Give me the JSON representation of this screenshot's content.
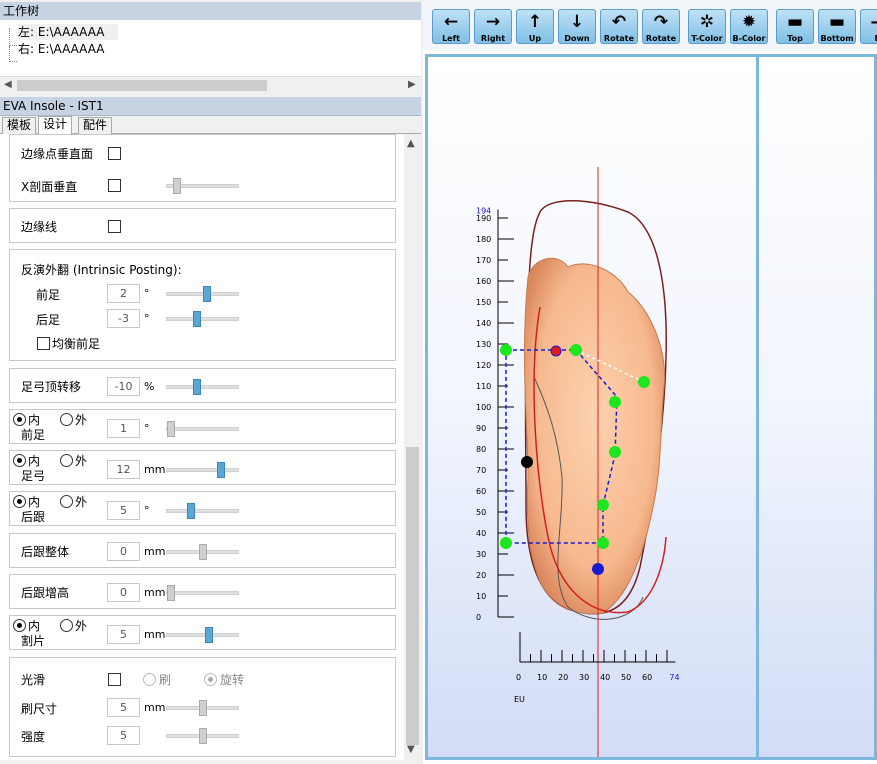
{
  "worktree": {
    "title": "工作树",
    "items": [
      "左: E:\\AAAAAA",
      "右: E:\\AAAAAA"
    ]
  },
  "section_title": "EVA Insole - IST1",
  "tabs": [
    "模板",
    "设计",
    "配件"
  ],
  "active_tab": 1,
  "settings": {
    "edge_vertical": "边缘点垂直面",
    "x_section_vertical": "X剖面垂直",
    "edge_line": "边缘线",
    "posting_title": "反演外翻 (Intrinsic Posting):",
    "forefoot": "前足",
    "forefoot_value": "2",
    "rearfoot": "后足",
    "rearfoot_value": "-3",
    "degree": "°",
    "balance_forefoot": "均衡前足",
    "arch_shift": "足弓顶转移",
    "arch_shift_value": "-10",
    "percent": "%",
    "inner": "内",
    "outer": "外",
    "forefoot_label": "前足",
    "forefoot2_value": "1",
    "arch_label": "足弓",
    "arch_value": "12",
    "mm": "mm",
    "heel_label": "后跟",
    "heel_value": "5",
    "heel_whole": "后跟整体",
    "heel_whole_value": "0",
    "heel_raise": "后跟增高",
    "heel_raise_value": "0",
    "cut_label": "割片",
    "cut_value": "5",
    "smooth": "光滑",
    "brush": "刷",
    "rotate": "旋转",
    "brush_size": "刷尺寸",
    "brush_size_value": "5",
    "strength": "强度",
    "strength_value": "5"
  },
  "toolbar": [
    {
      "label": "Left",
      "icon": "arrow-left-icon",
      "glyph": "←"
    },
    {
      "label": "Right",
      "icon": "arrow-right-icon",
      "glyph": "→"
    },
    {
      "label": "Up",
      "icon": "arrow-up-icon",
      "glyph": "↑"
    },
    {
      "label": "Down",
      "icon": "arrow-down-icon",
      "glyph": "↓"
    },
    {
      "label": "Rotate",
      "icon": "rotate-ccw-icon",
      "glyph": "↶"
    },
    {
      "label": "Rotate",
      "icon": "rotate-cw-icon",
      "glyph": "↷"
    },
    {
      "label": "T-Color",
      "icon": "top-color-icon",
      "glyph": "✲"
    },
    {
      "label": "B-Color",
      "icon": "bottom-color-icon",
      "glyph": "✹"
    },
    {
      "label": "Top",
      "icon": "top-view-icon",
      "glyph": "▬"
    },
    {
      "label": "Bottom",
      "icon": "bottom-view-icon",
      "glyph": "▬"
    },
    {
      "label": "Fr",
      "icon": "front-view-icon",
      "glyph": "—"
    }
  ],
  "ruler": {
    "y_max_label": "194",
    "y_ticks": [
      190,
      180,
      170,
      160,
      150,
      140,
      130,
      120,
      110,
      100,
      90,
      80,
      70,
      60,
      50,
      40,
      30,
      20,
      10,
      0
    ],
    "x_ticks": [
      0,
      10,
      20,
      30,
      40,
      50,
      60
    ],
    "x_max_label": "74",
    "x_unit": "EU"
  },
  "colors": {
    "accent": "#5aa7d6",
    "header": "#c7d3e3",
    "green_point": "#1ee61e",
    "red_point": "#e31b1b",
    "blue_point": "#1a1ad6",
    "view_border": "#7cb8dc"
  }
}
